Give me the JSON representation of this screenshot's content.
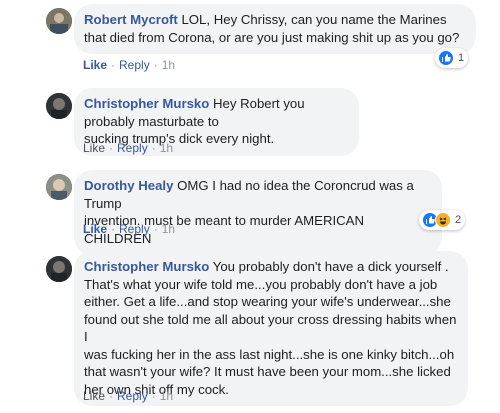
{
  "comments": [
    {
      "author": "Robert Mycroft",
      "lines": [
        "LOL, Hey Chrissy, can you name the Marines",
        "that died from Corona, or are you just making shit up as you go?"
      ],
      "like": "Like",
      "reply": "Reply",
      "time": "1h",
      "reaction_count": "1"
    },
    {
      "author": "Christopher Mursko",
      "lines": [
        "Hey Robert you probably masturbate to",
        "sucking trump's dick every night."
      ],
      "like": "Like",
      "reply": "Reply",
      "time": "1h"
    },
    {
      "author": "Dorothy Healy",
      "lines": [
        "OMG I had no idea the Coroncrud was a Trump",
        "invention. must be meant to murder AMERICAN CHILDREN"
      ],
      "like": "Like",
      "reply": "Reply",
      "time": "1h",
      "reaction_count": "2"
    },
    {
      "author": "Christopher Mursko",
      "lines": [
        "You probably don't have a dick yourself .",
        "That's what your wife told me...you probably don't have a job",
        "either. Get a life...and stop wearing your wife's underwear...she",
        "found out she told me all about your cross dressing habits when I",
        "was fucking her in the ass last night...she is one kinky bitch...oh",
        "that wasn't your wife? It must have been your mom...she licked",
        "her own shit off my cock."
      ],
      "like": "Like",
      "reply": "Reply",
      "time": "1h"
    }
  ],
  "icons": {
    "like_reaction": "like-reaction-icon",
    "haha_reaction": "haha-reaction-icon"
  },
  "colors": {
    "author": "#385898",
    "bubble": "#f2f3f5",
    "like_reaction": "#1877f2",
    "haha_reaction": "#f7b125"
  }
}
